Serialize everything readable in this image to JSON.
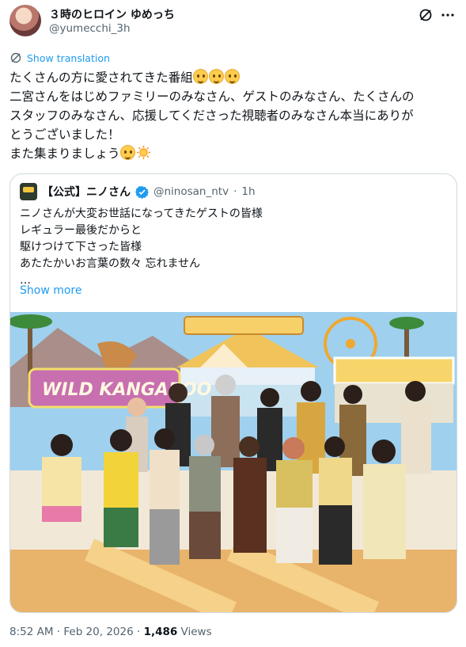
{
  "author": {
    "display_name": "３時のヒロイン ゆめっち",
    "handle": "@yumecchi_3h"
  },
  "translate": {
    "label": "Show translation"
  },
  "tweet": {
    "lines": [
      "たくさんの方に愛されてきた番組",
      "二宮さんをはじめファミリーのみなさん、ゲストのみなさん、たくさんの",
      "スタッフのみなさん、応援してくださった視聴者のみなさん本当にありが",
      "とうございました！",
      "また集まりましょう"
    ]
  },
  "quoted": {
    "display_name": "【公式】ニノさん",
    "handle": "@ninosan_ntv",
    "separator": "·",
    "time": "1h",
    "lines": [
      "ニノさんが大変お世話になってきたゲストの皆様",
      "レギュラー最後だからと",
      "駆けつけて下さった皆様",
      "あたたかいお言葉の数々 忘れません",
      "…"
    ],
    "show_more": "Show more",
    "photo_sign_text": "WILD KANGAROO"
  },
  "footer": {
    "timestamp": "8:52 AM · Feb 20, 2026 · ",
    "views_count": "1,486",
    "views_label": " Views"
  },
  "colors": {
    "accent": "#1d9bf0",
    "text": "#0f1419",
    "muted": "#536471",
    "border": "#cfd9de"
  },
  "icons": [
    "grok-icon",
    "more-icon",
    "translate-icon",
    "verified-badge-icon",
    "pleading-face-emoji",
    "sun-emoji"
  ]
}
